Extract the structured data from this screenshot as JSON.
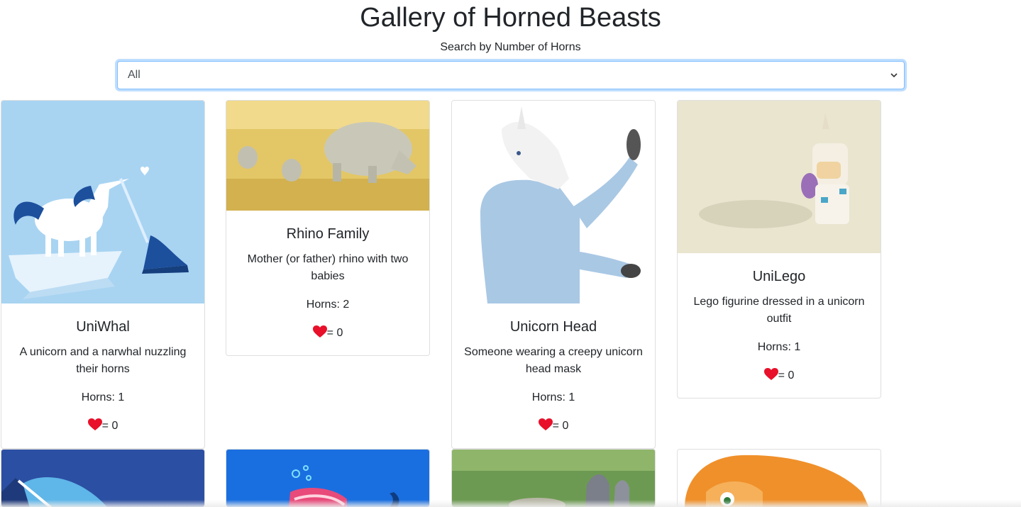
{
  "page": {
    "title": "Gallery of Horned Beasts",
    "search_label": "Search by Number of Horns",
    "filter": {
      "selected": "All"
    }
  },
  "colors": {
    "select_focus_border": "#80bdff",
    "card_border": "#dfdfdf",
    "heart": "#e8102a",
    "text": "#212529"
  },
  "cards": [
    {
      "title": "UniWhal",
      "description": "A unicorn and a narwhal nuzzling their horns",
      "horns": "Horns: 1",
      "likes": "= 0",
      "icon": "heart-icon"
    },
    {
      "title": "Rhino Family",
      "description": "Mother (or father) rhino with two babies",
      "horns": "Horns: 2",
      "likes": "= 0",
      "icon": "heart-icon"
    },
    {
      "title": "Unicorn Head",
      "description": "Someone wearing a creepy unicorn head mask",
      "horns": "Horns: 1",
      "likes": "= 0",
      "icon": "heart-icon"
    },
    {
      "title": "UniLego",
      "description": "Lego figurine dressed in a unicorn outfit",
      "horns": "Horns: 1",
      "likes": "= 0",
      "icon": "heart-icon"
    }
  ]
}
